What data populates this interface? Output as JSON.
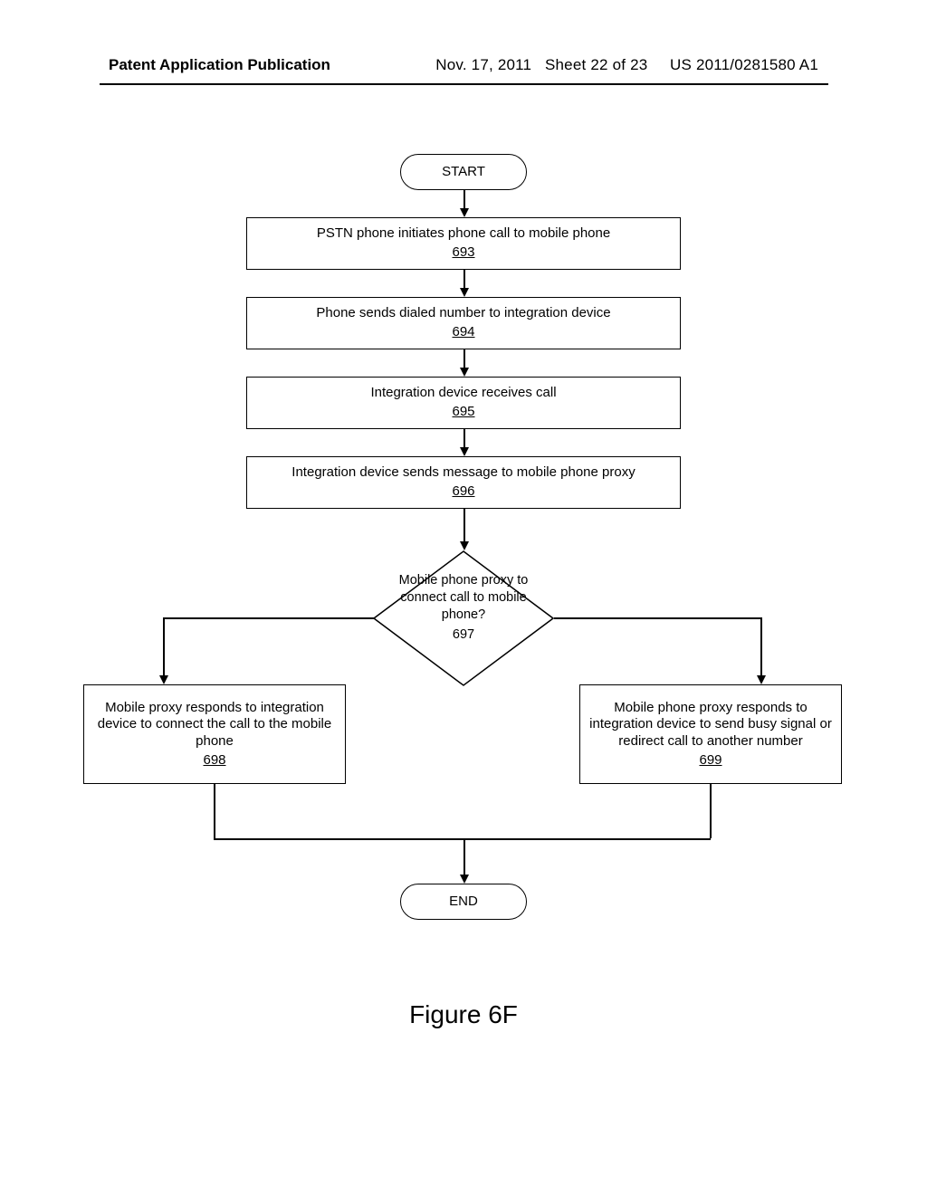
{
  "header": {
    "left": "Patent Application Publication",
    "date": "Nov. 17, 2011",
    "sheet": "Sheet 22 of 23",
    "pubno": "US 2011/0281580 A1"
  },
  "flowchart": {
    "start": "START",
    "end": "END",
    "steps": {
      "s693": {
        "text": "PSTN phone initiates phone call to mobile phone",
        "ref": "693"
      },
      "s694": {
        "text": "Phone sends dialed number to integration device",
        "ref": "694"
      },
      "s695": {
        "text": "Integration device receives call",
        "ref": "695"
      },
      "s696": {
        "text": "Integration device sends message to mobile phone proxy",
        "ref": "696"
      }
    },
    "decision": {
      "text": "Mobile phone proxy to connect call to mobile phone?",
      "ref": "697"
    },
    "branches": {
      "left": {
        "text": "Mobile proxy responds to integration device to connect the call to the mobile phone",
        "ref": "698"
      },
      "right": {
        "text": "Mobile phone proxy responds to integration device to send busy signal or redirect call to another number",
        "ref": "699"
      }
    }
  },
  "figure_label": "Figure 6F"
}
